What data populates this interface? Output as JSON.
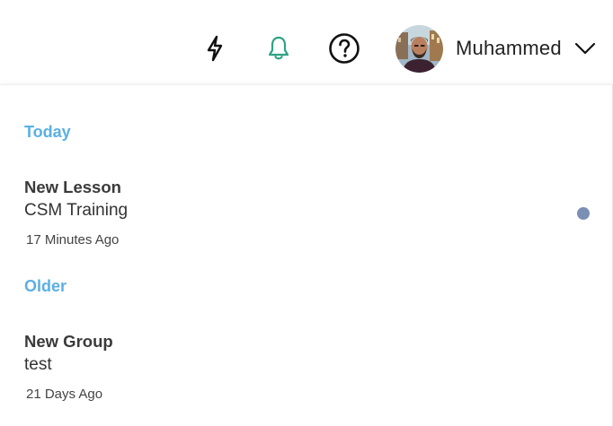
{
  "header": {
    "icons": {
      "bolt": "bolt-icon",
      "bell": "bell-icon",
      "help": "help-icon",
      "chevron": "chevron-down-icon"
    },
    "bell_color": "#2fa384",
    "user": {
      "name": "Muhammed"
    }
  },
  "notifications": {
    "sections": [
      {
        "label": "Today",
        "items": [
          {
            "title": "New Lesson",
            "body": "CSM Training",
            "time": "17 Minutes Ago",
            "unread": true
          }
        ]
      },
      {
        "label": "Older",
        "items": [
          {
            "title": "New Group",
            "body": "test",
            "time": "21 Days Ago",
            "unread": false
          }
        ]
      }
    ],
    "section_label_color": "#5ab0e6",
    "unread_dot_color": "#7a8fb3"
  }
}
